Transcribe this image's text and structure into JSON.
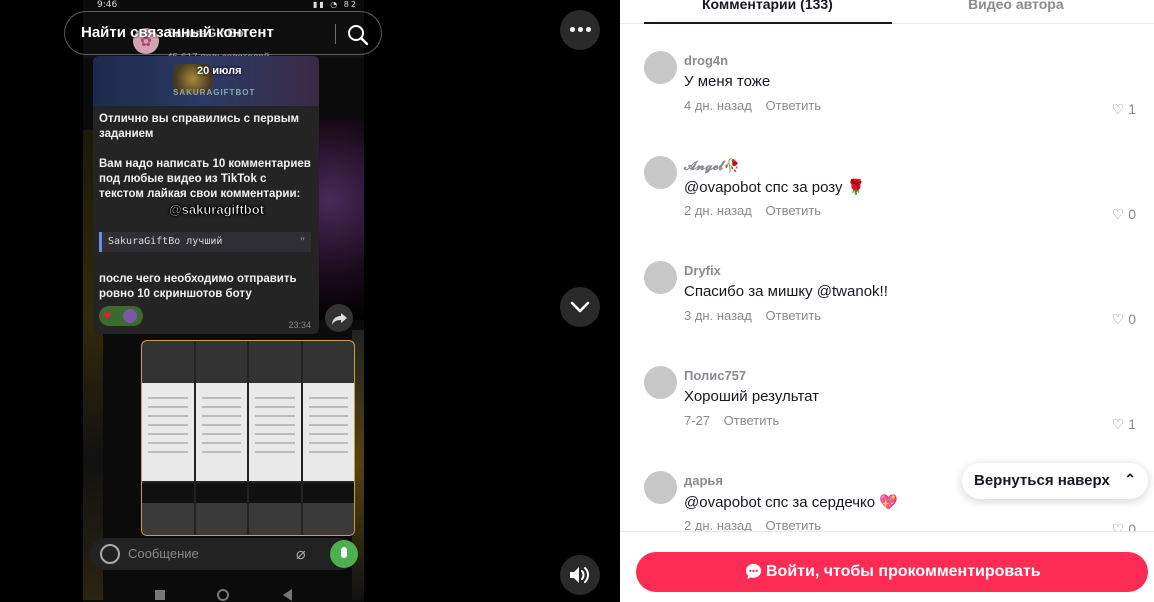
{
  "video": {
    "status_time": "9:46",
    "status_icons": "▮▮ ◔ 82",
    "telegram": {
      "channel_name": "SakuraGiftBot",
      "subscribers": "45,617 пользователей",
      "date_label": "20 июля",
      "brand_text": "SAKURAGIFTBOT",
      "message_text": "Отлично вы справились с первым заданием\n\nВам надо написать 10 комментариев под любые видео из TikTok с текстом лайкая свои комментарии:",
      "quote": "SakuraGiftBo лучший",
      "message_text_2": "после чего необходимо отправить ровно 10 скриншотов боту",
      "message_time": "23:34",
      "composer_placeholder": "Сообщение"
    },
    "overlay_tag": "@sakuragiftbot",
    "related_label": "Найти связанный контент",
    "screens_grid_thumbnails": 8
  },
  "comments_panel": {
    "tabs": [
      {
        "label": "Комментарии (133)",
        "active": true
      },
      {
        "label": "Видео автора",
        "active": false
      }
    ],
    "comments": [
      {
        "username": "drog4n",
        "text": "У меня тоже",
        "time": "4 дн. назад",
        "reply": "Ответить",
        "likes": "1"
      },
      {
        "username": "𝓐𝓷𝓰𝓮𝓵🥀",
        "text": "@ovapobot спс за розу 🌹",
        "time": "2 дн. назад",
        "reply": "Ответить",
        "likes": "0"
      },
      {
        "username": "Dryfix",
        "text": "Спасибо за мишку @twanok!!",
        "time": "3 дн. назад",
        "reply": "Ответить",
        "likes": "0"
      },
      {
        "username": "Полис757",
        "text": "Хороший результат",
        "time": "7-27",
        "reply": "Ответить",
        "likes": "1"
      },
      {
        "username": "дарья",
        "text": "@ovapobot спс за сердечко 💖",
        "time": "2 дн. назад",
        "reply": "Ответить",
        "likes": "0"
      }
    ],
    "back_to_top": "Вернуться наверх",
    "login_button": "Войти, чтобы прокомментировать"
  },
  "colors": {
    "accent": "#fe2c55",
    "text_primary": "#161823",
    "text_secondary": "#8a8b91",
    "telegram_mic": "#4caf50"
  },
  "icons": [
    "more-icon",
    "chevron-down-icon",
    "volume-icon",
    "search-icon",
    "heart-icon",
    "chevrons-up-icon",
    "comment-icon",
    "share-icon",
    "emoji-icon",
    "paperclip-icon",
    "mic-icon"
  ]
}
